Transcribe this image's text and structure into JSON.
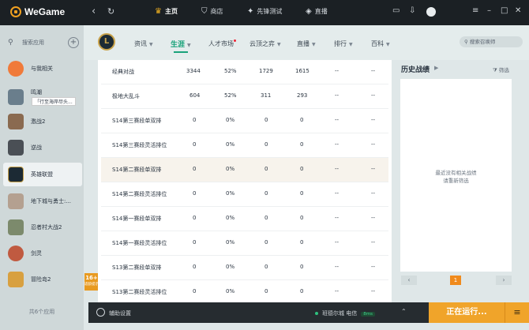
{
  "app": {
    "title": "WeGame"
  },
  "topnav": [
    {
      "label": "主页",
      "icon": "home-icon",
      "glyph": "♛"
    },
    {
      "label": "商店",
      "icon": "store-icon",
      "glyph": "⛉"
    },
    {
      "label": "先锋测试",
      "icon": "gamepad-icon",
      "glyph": "✦"
    },
    {
      "label": "直播",
      "icon": "live-icon",
      "glyph": "◈"
    }
  ],
  "sidebar": {
    "search_placeholder": "搜索应用",
    "games": [
      {
        "name": "与我相关",
        "color": "#f07a3a"
      },
      {
        "name": "鸣潮",
        "sub": "「行至海岸尽头...",
        "color": "#6a7e8c"
      },
      {
        "name": "激战2",
        "color": "#8a6a50"
      },
      {
        "name": "逆战",
        "color": "#4a4f55"
      },
      {
        "name": "英雄联盟",
        "color": "#1c2a34"
      },
      {
        "name": "地下城与勇士:...",
        "color": "#b4a090"
      },
      {
        "name": "忍者村大战2",
        "color": "#7c8a6c"
      },
      {
        "name": "剑灵",
        "color": "#c05a40"
      },
      {
        "name": "冒险岛2",
        "color": "#d8a040"
      }
    ],
    "footer": "共6个应用",
    "age_badge": "16+",
    "age_sub": "适龄提示"
  },
  "game_header": {
    "logo_text": "L",
    "tabs": [
      {
        "label": "资讯"
      },
      {
        "label": "生涯"
      },
      {
        "label": "人才市场"
      },
      {
        "label": "云顶之弈"
      },
      {
        "label": "直播"
      },
      {
        "label": "排行"
      },
      {
        "label": "百科"
      }
    ],
    "search_placeholder": "搜索召唤师"
  },
  "table": {
    "rows": [
      [
        "经典对战",
        "3344",
        "52%",
        "1729",
        "1615",
        "--",
        "--"
      ],
      [
        "极地大乱斗",
        "604",
        "52%",
        "311",
        "293",
        "--",
        "--"
      ],
      [
        "S14第三赛段单双排",
        "0",
        "0%",
        "0",
        "0",
        "--",
        "--"
      ],
      [
        "S14第三赛段灵活排位",
        "0",
        "0%",
        "0",
        "0",
        "--",
        "--"
      ],
      [
        "S14第二赛段单双排",
        "0",
        "0%",
        "0",
        "0",
        "--",
        "--"
      ],
      [
        "S14第二赛段灵活排位",
        "0",
        "0%",
        "0",
        "0",
        "--",
        "--"
      ],
      [
        "S14第一赛段单双排",
        "0",
        "0%",
        "0",
        "0",
        "--",
        "--"
      ],
      [
        "S14第一赛段灵活排位",
        "0",
        "0%",
        "0",
        "0",
        "--",
        "--"
      ],
      [
        "S13第二赛段单双排",
        "0",
        "0%",
        "0",
        "0",
        "--",
        "--"
      ],
      [
        "S13第二赛段灵活排位",
        "0",
        "0%",
        "0",
        "0",
        "--",
        "--"
      ]
    ]
  },
  "history": {
    "title": "历史战绩",
    "filter": "筛选",
    "empty_line1": "最近没有相关战绩",
    "empty_line2": "请重新筛选",
    "page": "1"
  },
  "bottombar": {
    "assist": "辅助设置",
    "server": "班德尔城 电信",
    "ping": "8ms",
    "running": "正在运行..."
  }
}
